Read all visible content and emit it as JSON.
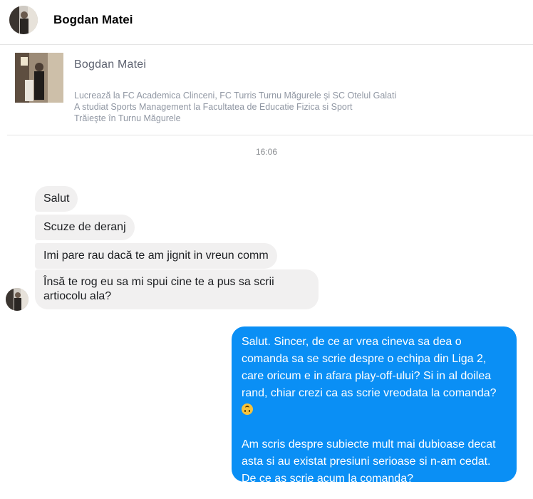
{
  "header": {
    "name": "Bogdan Matei"
  },
  "profile": {
    "name": "Bogdan Matei",
    "info": [
      "Lucrează la FC Academica Clinceni, FC Turris Turnu Măgurele şi SC Otelul Galati",
      "A studiat Sports Management la Facultatea de Educatie Fizica si Sport",
      "Trăieşte în Turnu Măgurele"
    ]
  },
  "timestamp": "16:06",
  "incoming": [
    "Salut",
    "Scuze de deranj",
    "Imi pare rau dacă te am jignit in vreun comm",
    "Însă te rog eu sa mi spui cine te a pus sa scrii artiocolu ala?"
  ],
  "outgoing": {
    "paragraph1": "Salut. Sincer, de ce ar vrea cineva sa dea o comanda sa se scrie despre o echipa din Liga 2, care oricum e in afara play-off-ului? Si in al doilea rand, chiar crezi ca as scrie vreodata la comanda?",
    "emoji": "upside-down-face-emoji",
    "paragraph2": "Am scris despre subiecte mult mai dubioase decat asta si au existat presiuni serioase si n-am cedat. De ce as scrie acum la comanda?"
  },
  "colors": {
    "outgoing_bubble": "#0a8ff5",
    "incoming_bubble": "#f1f0f0"
  }
}
